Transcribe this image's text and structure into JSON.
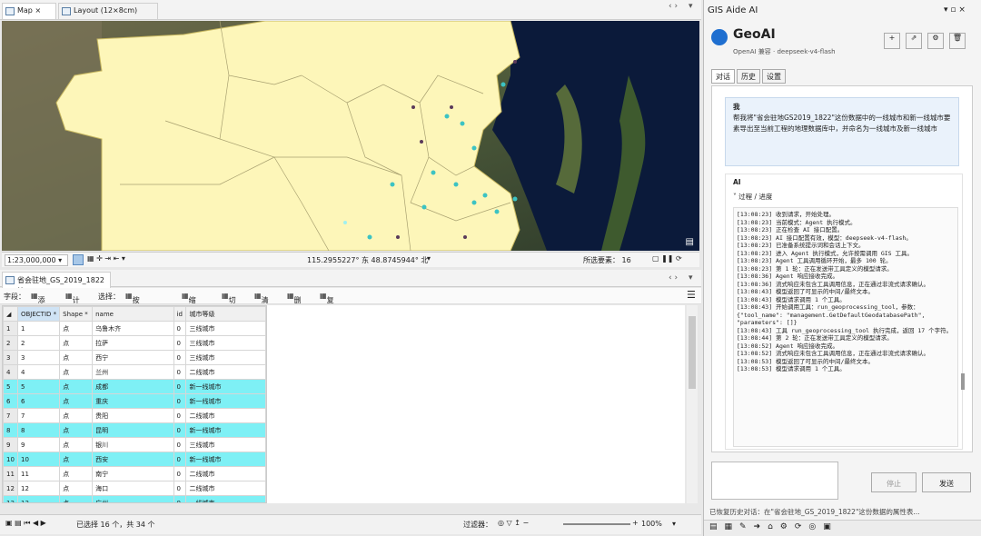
{
  "tabs": {
    "map": "Map",
    "layout": "Layout (12×8cm)"
  },
  "map": {
    "scale": "1:23,000,000",
    "coords": "115.2955227° 东 48.8745944° 北",
    "selected_label": "所选要素：",
    "selected_count": "16"
  },
  "table": {
    "title": "省会驻地_GS_2019_1822",
    "toolbar": {
      "fields": "字段：",
      "add": "添加",
      "calc": "计算",
      "select": "选择：",
      "by_attr": "按属性选择",
      "zoom": "缩放至",
      "switch": "切换",
      "clear": "清除",
      "delete": "删除",
      "copy": "复制"
    },
    "headers": [
      "OBJECTID *",
      "Shape *",
      "name",
      "id",
      "城市等级"
    ],
    "rows": [
      {
        "n": "1",
        "oid": "1",
        "shape": "点",
        "name": "乌鲁木齐",
        "id": "0",
        "level": "三线城市",
        "sel": false
      },
      {
        "n": "2",
        "oid": "2",
        "shape": "点",
        "name": "拉萨",
        "id": "0",
        "level": "三线城市",
        "sel": false
      },
      {
        "n": "3",
        "oid": "3",
        "shape": "点",
        "name": "西宁",
        "id": "0",
        "level": "三线城市",
        "sel": false
      },
      {
        "n": "4",
        "oid": "4",
        "shape": "点",
        "name": "兰州",
        "id": "0",
        "level": "二线城市",
        "sel": false
      },
      {
        "n": "5",
        "oid": "5",
        "shape": "点",
        "name": "成都",
        "id": "0",
        "level": "新一线城市",
        "sel": true
      },
      {
        "n": "6",
        "oid": "6",
        "shape": "点",
        "name": "重庆",
        "id": "0",
        "level": "新一线城市",
        "sel": true
      },
      {
        "n": "7",
        "oid": "7",
        "shape": "点",
        "name": "贵阳",
        "id": "0",
        "level": "二线城市",
        "sel": false
      },
      {
        "n": "8",
        "oid": "8",
        "shape": "点",
        "name": "昆明",
        "id": "0",
        "level": "新一线城市",
        "sel": true
      },
      {
        "n": "9",
        "oid": "9",
        "shape": "点",
        "name": "银川",
        "id": "0",
        "level": "三线城市",
        "sel": false
      },
      {
        "n": "10",
        "oid": "10",
        "shape": "点",
        "name": "西安",
        "id": "0",
        "level": "新一线城市",
        "sel": true
      },
      {
        "n": "11",
        "oid": "11",
        "shape": "点",
        "name": "南宁",
        "id": "0",
        "level": "二线城市",
        "sel": false
      },
      {
        "n": "12",
        "oid": "12",
        "shape": "点",
        "name": "海口",
        "id": "0",
        "level": "二线城市",
        "sel": false
      },
      {
        "n": "13",
        "oid": "13",
        "shape": "点",
        "name": "广州",
        "id": "0",
        "level": "一线城市",
        "sel": true
      }
    ],
    "status": "已选择 16 个，共 34 个",
    "filter": "过滤器：",
    "zoom": "100%"
  },
  "ai": {
    "panel_title": "GIS Aide AI",
    "name": "GeoAI",
    "provider": "OpenAI 兼容 · deepseek-v4-flash",
    "tabs": [
      "对话",
      "历史",
      "设置"
    ],
    "user_label": "我",
    "user_msg": "帮我将\"省会驻地GS2019_1822\"这份数据中的一线城市和新一线城市要素导出至当前工程的地理数据库中，并命名为一线城市及新一线城市",
    "ai_label": "AI",
    "progress": "过程 / 进度",
    "log": "[13:08:23] 收到请求，开始处理。\n[13:08:23] 当前模式：Agent 执行模式。\n[13:08:23] 正在检查 AI 接口配置。\n[13:08:23] AI 接口配置有效，模型：deepseek-v4-flash。\n[13:08:23] 已准备系统提示词和会话上下文。\n[13:08:23] 进入 Agent 执行模式，允许按需调用 GIS 工具。\n[13:08:23] Agent 工具调用循环开始，最多 100 轮。\n[13:08:23] 第 1 轮：正在发送带工具定义的模型请求。\n[13:08:36] Agent 响应接收完成。\n[13:08:36] 流式响应未包含工具调用信息，正在通过非流式请求确认。\n[13:08:43] 模型返回了可显示的中间/最终文本。\n[13:08:43] 模型请求调用 1 个工具。\n[13:08:43] 开始调用工具：run_geoprocessing_tool，参数：{\"tool_name\": \"management.GetDefaultGeodatabasePath\", \"parameters\": []}\n[13:08:43] 工具 run_geoprocessing_tool 执行完成，返回 17 个字符。\n[13:08:44] 第 2 轮：正在发送带工具定义的模型请求。\n[13:08:52] Agent 响应接收完成。\n[13:08:52] 流式响应未包含工具调用信息，正在通过非流式请求确认。\n[13:08:53] 模型返回了可显示的中间/最终文本。\n[13:08:53] 模型请求调用 1 个工具。",
    "stop": "停止",
    "send": "发送",
    "footer": "已恢复历史对话：在\"省会驻地_GS_2019_1822\"这份数据的属性表..."
  }
}
